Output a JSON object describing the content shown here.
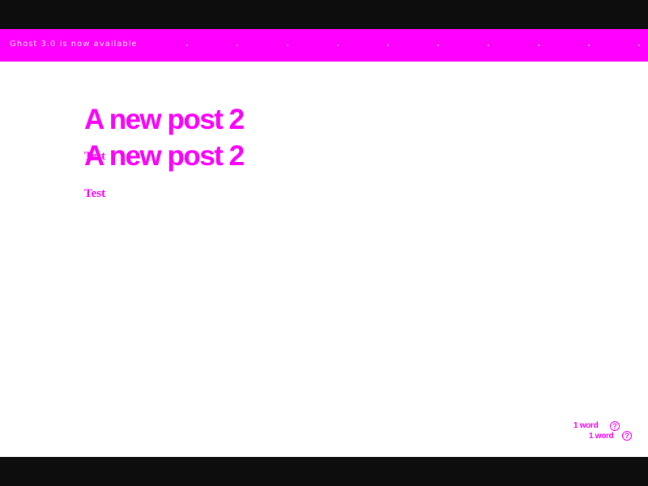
{
  "banner": {
    "text": "Ghost 3.0 is now available"
  },
  "editor": {
    "title": "A new post 2",
    "body": "Test",
    "word_count": "1 word",
    "help_icon": "help-circle-icon",
    "help_glyph": "?"
  },
  "colors": {
    "accent": "#ff00ff",
    "background": "#ffffff",
    "frame": "#0d0d0d"
  }
}
